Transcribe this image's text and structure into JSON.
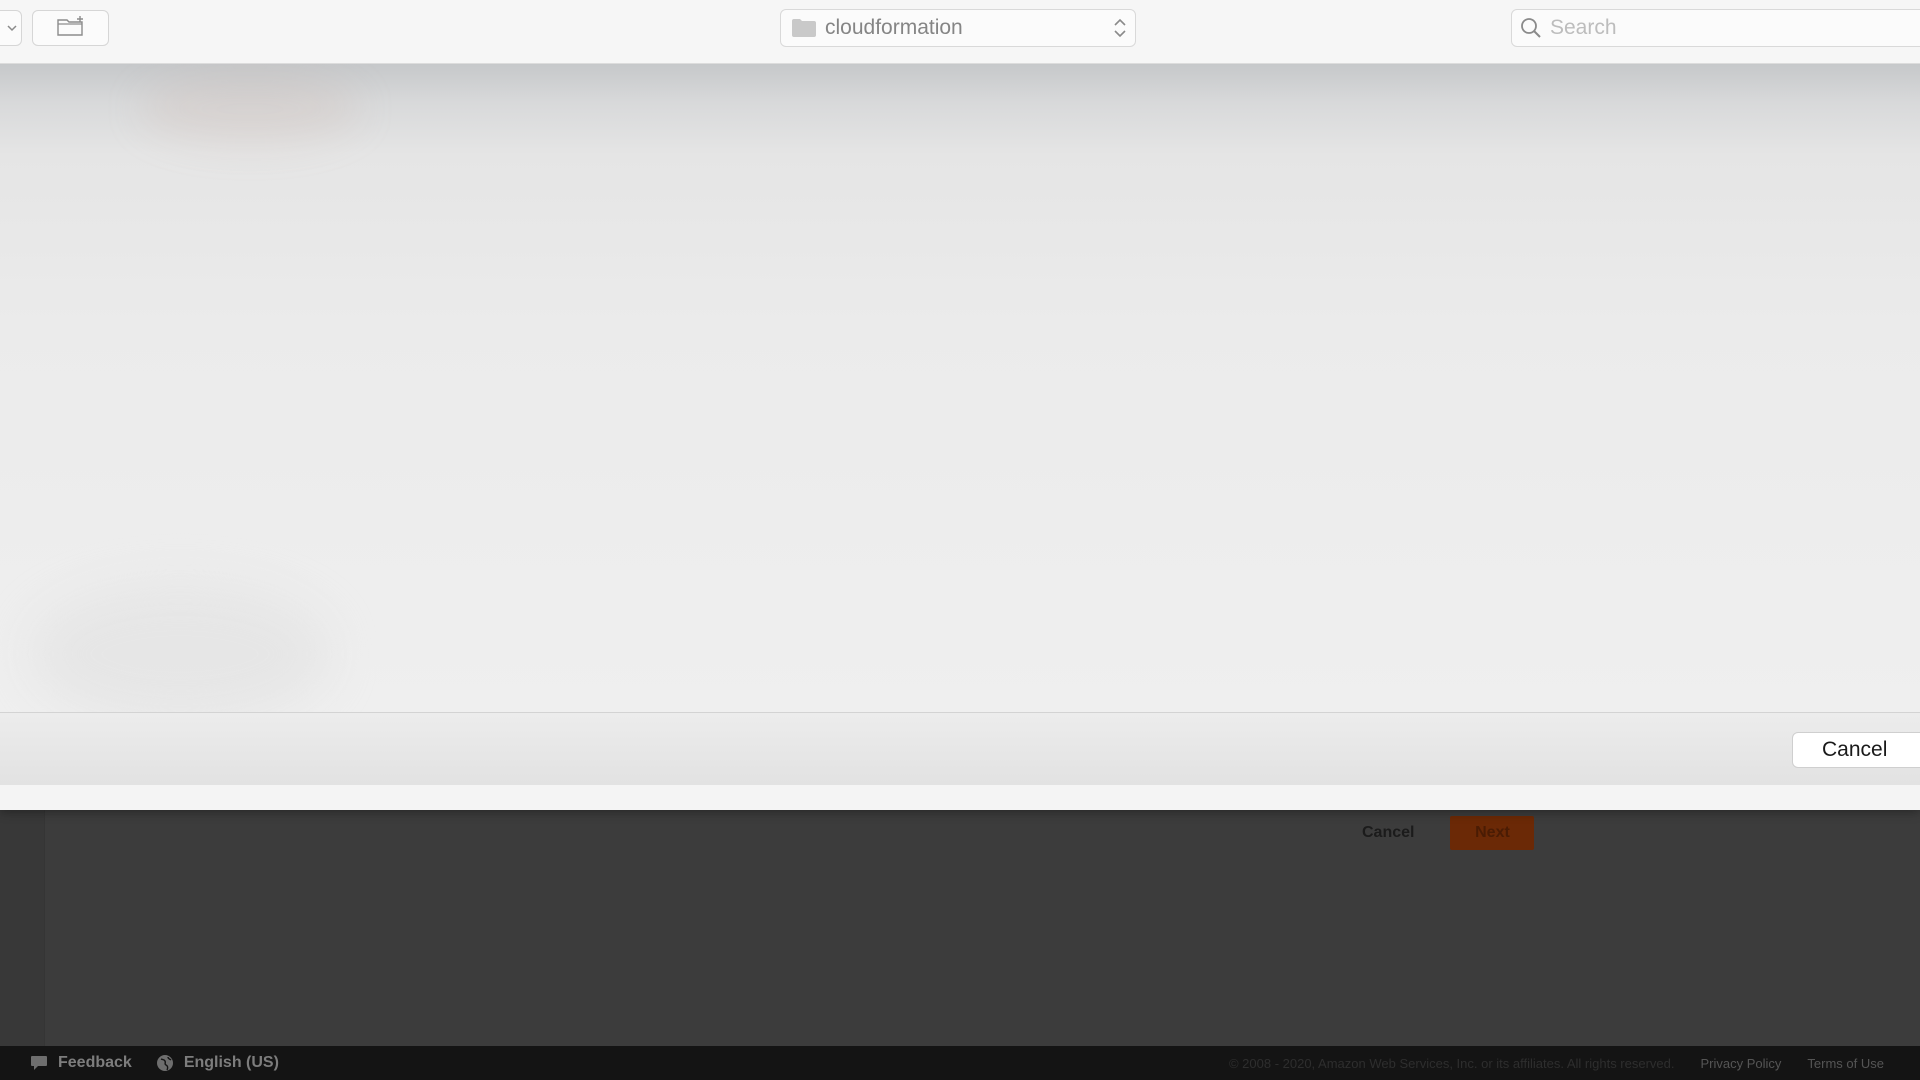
{
  "file_dialog": {
    "location": "cloudformation",
    "search_placeholder": "Search",
    "cancel_label": "Cancel"
  },
  "console": {
    "cancel_label": "Cancel",
    "next_label": "Next"
  },
  "footer": {
    "feedback_label": "Feedback",
    "language_label": "English (US)",
    "copyright": "© 2008 - 2020, Amazon Web Services, Inc. or its affiliates. All rights reserved.",
    "privacy_label": "Privacy Policy",
    "terms_label": "Terms of Use"
  },
  "colors": {
    "next_button": "#6b2906",
    "footer_bg": "#141414",
    "sheet_bg": "#f6f6f6"
  }
}
